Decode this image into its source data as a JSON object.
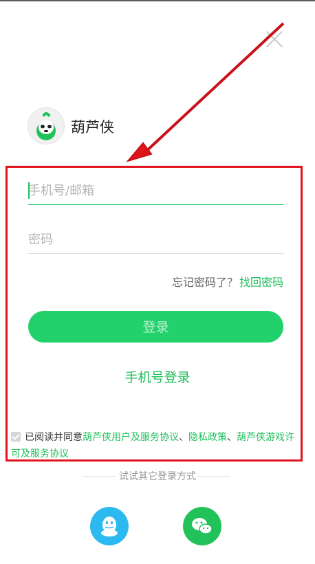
{
  "app": {
    "name": "葫芦侠",
    "logo_icon": "gourd-mascot-icon"
  },
  "login": {
    "account_placeholder": "手机号/邮箱",
    "password_placeholder": "密码",
    "forgot_text": "忘记密码了？",
    "find_password": "找回密码",
    "login_button": "登录",
    "phone_login": "手机号登录"
  },
  "agreement": {
    "prefix": "已阅读并同意",
    "user_agreement": "葫芦侠用户及服务协议",
    "sep1": "、",
    "privacy": "隐私政策",
    "sep2": "、",
    "game_license": "葫芦侠游戏许可及服务协议"
  },
  "other_login": {
    "label": "试试其它登录方式",
    "qq_icon": "qq-icon",
    "wechat_icon": "wechat-icon"
  },
  "colors": {
    "accent": "#22cc66",
    "highlight_border": "#e0141e",
    "qq": "#2bb9f0",
    "wechat": "#22c25a"
  }
}
